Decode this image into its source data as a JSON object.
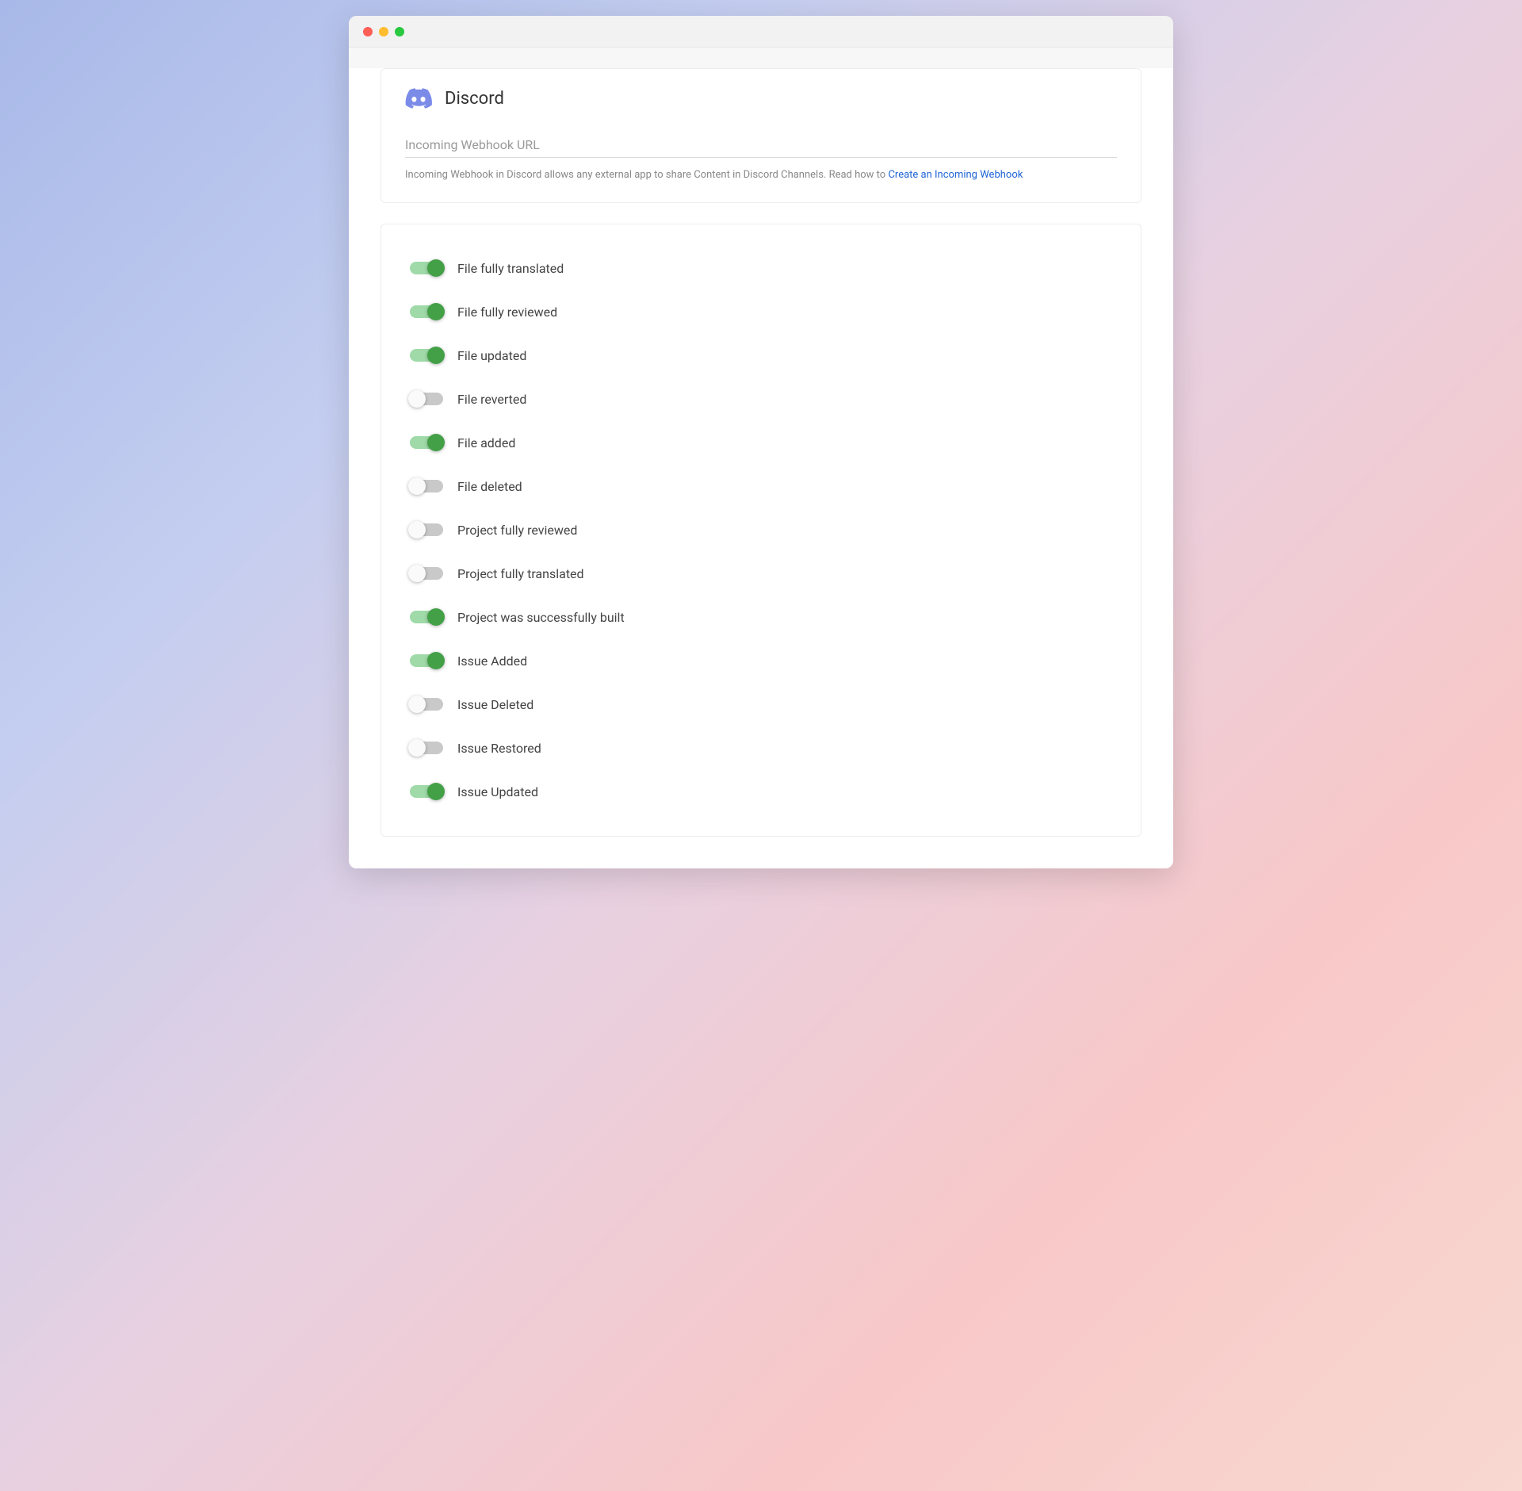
{
  "header": {
    "title": "Discord"
  },
  "webhook": {
    "placeholder": "Incoming Webhook URL",
    "helper_prefix": "Incoming Webhook in Discord allows any external app to share Content in Discord Channels. Read how to ",
    "helper_link": "Create an Incoming Webhook"
  },
  "toggles": [
    {
      "label": "File fully translated",
      "on": true
    },
    {
      "label": "File fully reviewed",
      "on": true
    },
    {
      "label": "File updated",
      "on": true
    },
    {
      "label": "File reverted",
      "on": false
    },
    {
      "label": "File added",
      "on": true
    },
    {
      "label": "File deleted",
      "on": false
    },
    {
      "label": "Project fully reviewed",
      "on": false
    },
    {
      "label": "Project fully translated",
      "on": false
    },
    {
      "label": "Project was successfully built",
      "on": true
    },
    {
      "label": "Issue Added",
      "on": true
    },
    {
      "label": "Issue Deleted",
      "on": false
    },
    {
      "label": "Issue Restored",
      "on": false
    },
    {
      "label": "Issue Updated",
      "on": true
    }
  ]
}
